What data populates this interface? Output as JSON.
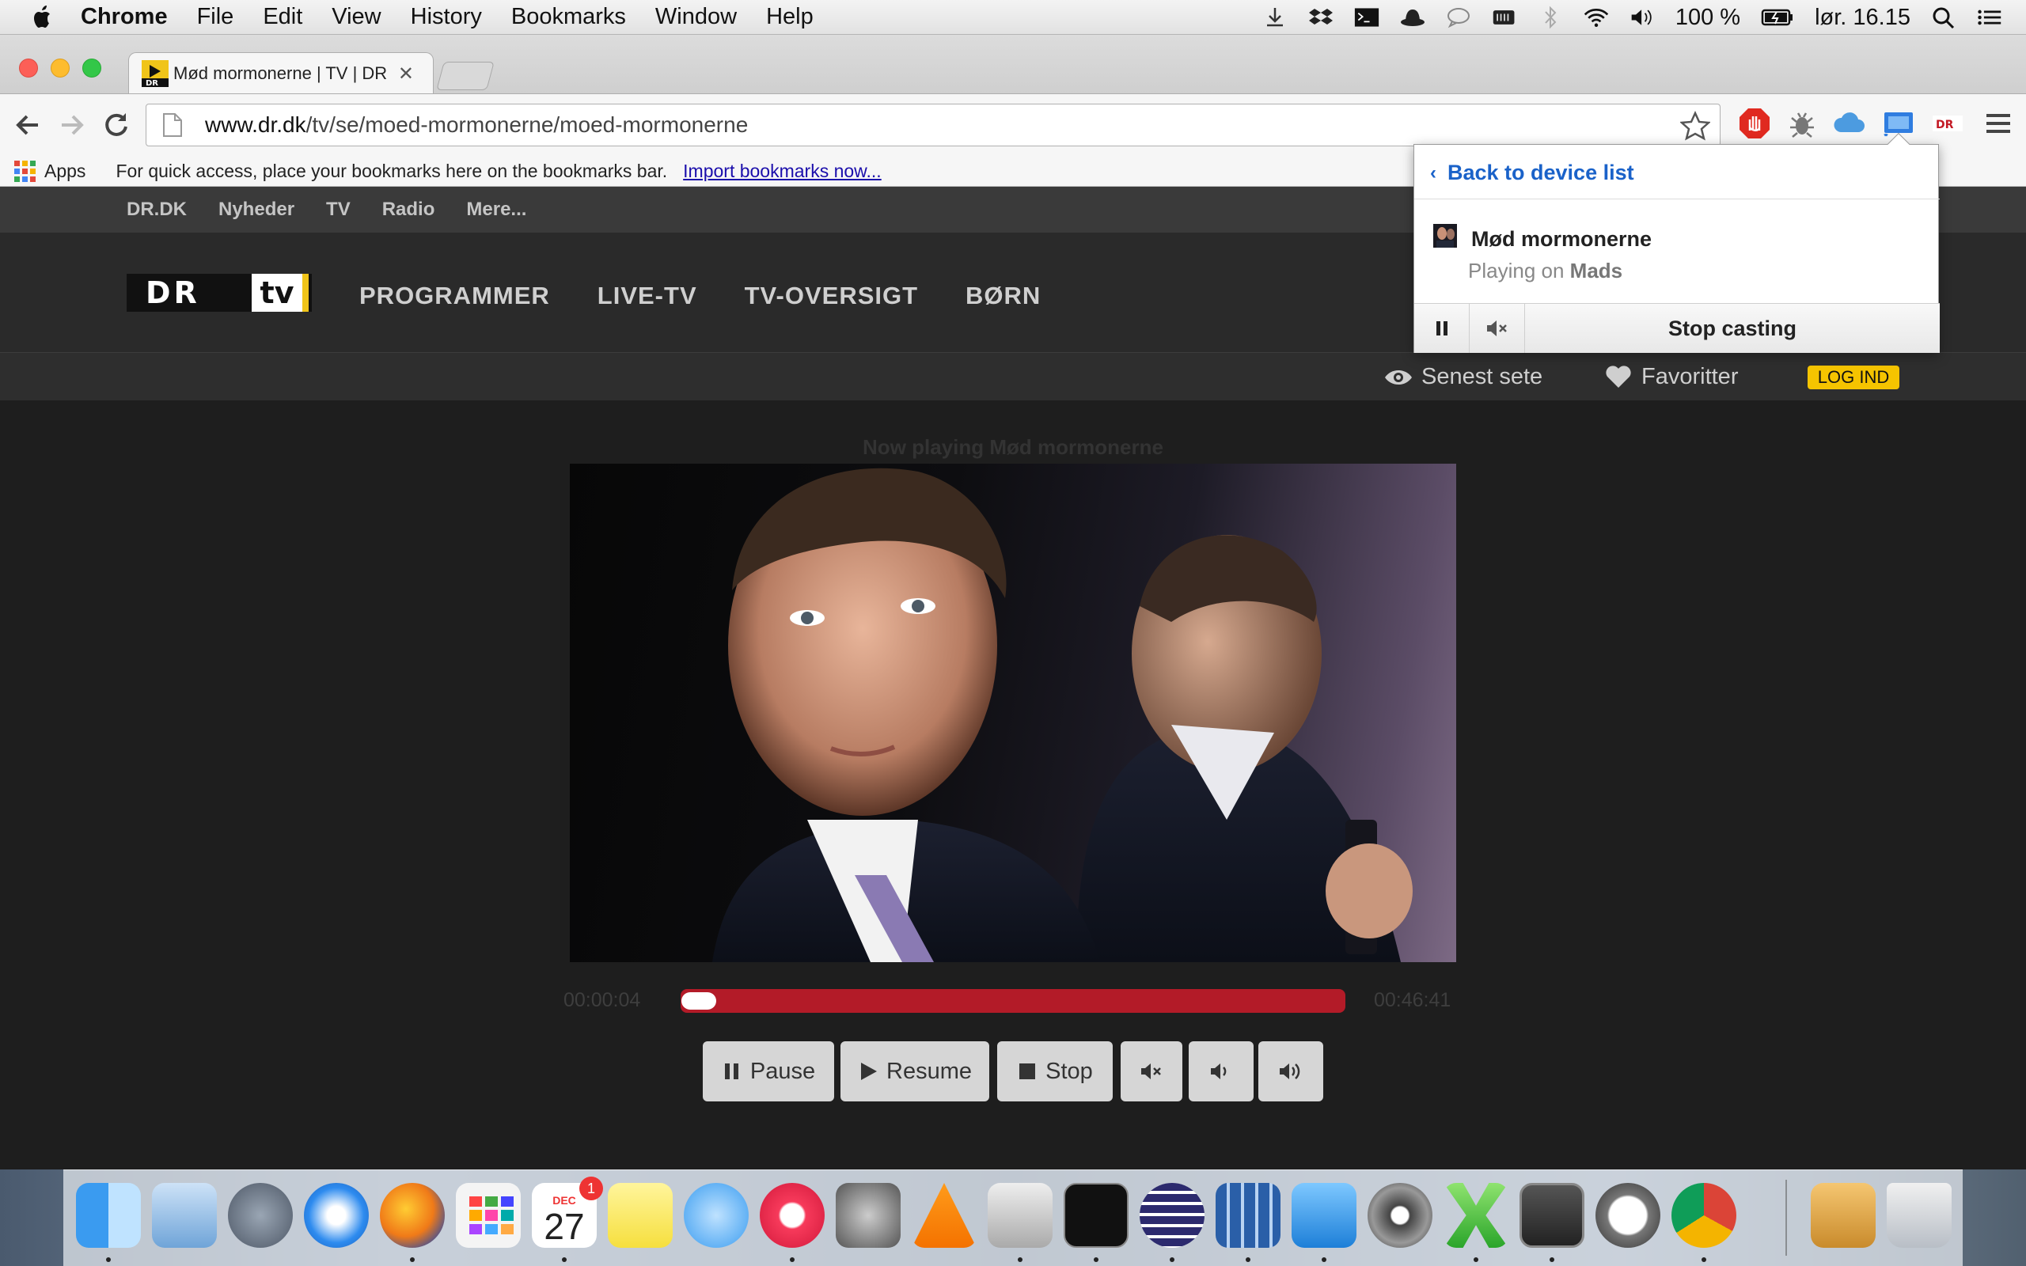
{
  "menubar": {
    "app_name": "Chrome",
    "items": [
      "File",
      "Edit",
      "View",
      "History",
      "Bookmarks",
      "Window",
      "Help"
    ],
    "battery": "100 %",
    "clock": "lør. 16.15"
  },
  "tab": {
    "title": "Mød mormonerne | TV | DR",
    "close": "✕"
  },
  "omnibox": {
    "host": "www.dr.dk",
    "path": "/tv/se/moed-mormonerne/moed-mormonerne"
  },
  "bookmarks_bar": {
    "apps_label": "Apps",
    "hint": "For quick access, place your bookmarks here on the bookmarks bar.",
    "import_link": "Import bookmarks now..."
  },
  "dr_topnav": [
    "DR.DK",
    "Nyheder",
    "TV",
    "Radio",
    "Mere..."
  ],
  "dr_mainnav": [
    "PROGRAMMER",
    "LIVE-TV",
    "TV-OVERSIGT",
    "BØRN"
  ],
  "dr_logo": {
    "dr": "DR",
    "tv": "tv"
  },
  "dr_subbar": {
    "recent": "Senest sete",
    "favorites": "Favoritter",
    "login": "LOG IND"
  },
  "player": {
    "now_playing": "Now playing Mød mormonerne",
    "elapsed": "00:00:04",
    "duration": "00:46:41",
    "progress": 0.0014,
    "buttons": {
      "pause": "Pause",
      "resume": "Resume",
      "stop": "Stop"
    }
  },
  "cast_popup": {
    "back": "Back to device list",
    "title": "Mød mormonerne",
    "playing_on": "Playing on",
    "device": "Mads",
    "stop": "Stop casting"
  },
  "colors": {
    "accent_link": "#1a62c9",
    "progress_red": "#b31b28",
    "dr_yellow": "#f5c400"
  },
  "dock": {
    "calendar_month": "DEC",
    "calendar_day": "27",
    "calendar_badge": "1",
    "icons": [
      "finder-icon",
      "mail-icon",
      "launchpad-icon",
      "safari-icon",
      "firefox-icon",
      "launchpad-grid-icon",
      "calendar-icon",
      "notes-icon",
      "messages-icon",
      "itunes-icon",
      "system-preferences-icon",
      "vlc-icon",
      "transmission-icon",
      "terminal-icon",
      "eclipse-icon",
      "activity-icon",
      "word-icon",
      "camera-icon",
      "excel-icon",
      "sublime-icon",
      "sequel-icon",
      "chrome-icon",
      "downloads-icon",
      "trash-icon"
    ]
  }
}
